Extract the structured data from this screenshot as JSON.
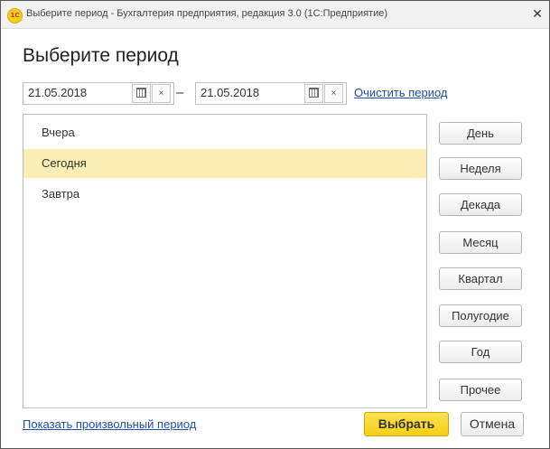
{
  "window": {
    "title": "Выберите период - Бухгалтерия предприятия, редакция 3.0  (1С:Предприятие)",
    "icon_label": "1С",
    "close_glyph": "✕"
  },
  "header": {
    "title": "Выберите период"
  },
  "period": {
    "start_date": "21.05.2018",
    "end_date": "21.05.2018",
    "separator": "–",
    "clear_glyph": "×",
    "clear_link": "Очистить период"
  },
  "list": {
    "items": [
      {
        "label": "Вчера",
        "selected": false
      },
      {
        "label": "Сегодня",
        "selected": true
      },
      {
        "label": "Завтра",
        "selected": false
      }
    ]
  },
  "period_buttons": [
    "День",
    "Неделя",
    "Декада",
    "Месяц",
    "Квартал",
    "Полугодие",
    "Год",
    "Прочее"
  ],
  "footer": {
    "custom_period_link": "Показать произвольный период",
    "select_label": "Выбрать",
    "cancel_label": "Отмена"
  },
  "colors": {
    "accent_button": "#f5d327",
    "selection": "#fbeeb4",
    "link": "#1f4fa8"
  },
  "icons": [
    "app-1c-icon",
    "close-icon",
    "calendar-icon",
    "clear-icon"
  ]
}
